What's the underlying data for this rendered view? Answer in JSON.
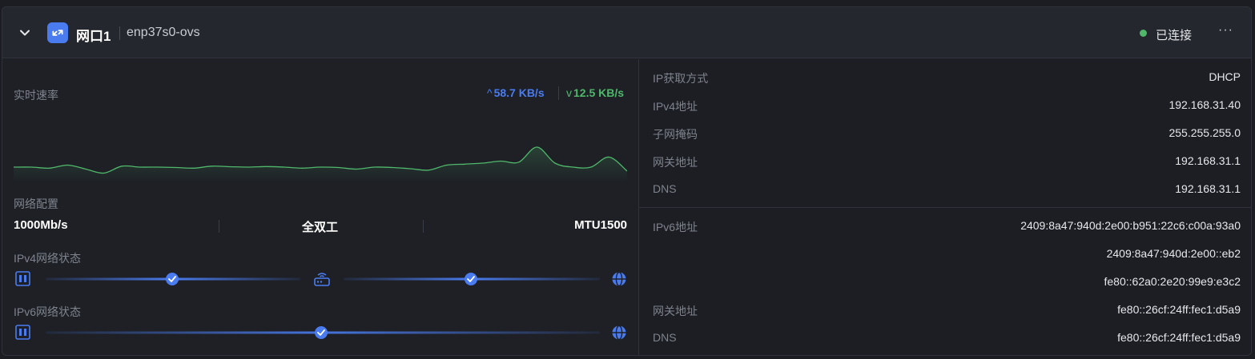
{
  "header": {
    "port_name": "网口1",
    "iface_name": "enp37s0-ovs",
    "status_text": "已连接",
    "status_color": "#4fb86b",
    "accent_color": "#4a7cf0",
    "more_label": "···"
  },
  "speed": {
    "label": "实时速率",
    "upload": "58.7 KB/s",
    "download": "12.5 KB/s",
    "upload_color": "#4a7cf0",
    "download_color": "#4fb86b"
  },
  "chart_data": {
    "type": "area",
    "series": [
      {
        "values": [
          8,
          8,
          7.5,
          9,
          7,
          5,
          8.5,
          8,
          8,
          7.8,
          7.5,
          8.5,
          8.2,
          8,
          8.3,
          8,
          7.5,
          8,
          7.8,
          7,
          8,
          7.8,
          7.2,
          6.5,
          9,
          9.5,
          10,
          11,
          10.5,
          18,
          10,
          8,
          8,
          13,
          6
        ]
      }
    ],
    "ylim": [
      0,
      24
    ],
    "grid": false
  },
  "config": {
    "label": "网络配置",
    "speed": "1000Mb/s",
    "duplex": "全双工",
    "mtu": "MTU1500"
  },
  "ipv4_status": {
    "label": "IPv4网络状态"
  },
  "ipv6_status": {
    "label": "IPv6网络状态"
  },
  "icons": {
    "chevron": "chevron-down-icon",
    "port": "swap-arrows-icon",
    "nic": "network-card-icon",
    "router": "router-icon",
    "globe": "globe-icon",
    "check": "check-circle-icon"
  },
  "ipv4": [
    {
      "key": "IP获取方式",
      "value": "DHCP"
    },
    {
      "key": "IPv4地址",
      "value": "192.168.31.40"
    },
    {
      "key": "子网掩码",
      "value": "255.255.255.0"
    },
    {
      "key": "网关地址",
      "value": "192.168.31.1"
    },
    {
      "key": "DNS",
      "value": "192.168.31.1"
    }
  ],
  "ipv6": [
    {
      "key": "IPv6地址",
      "value": "2409:8a47:940d:2e00:b951:22c6:c00a:93a0"
    },
    {
      "key": "",
      "value": "2409:8a47:940d:2e00::eb2"
    },
    {
      "key": "",
      "value": "fe80::62a0:2e20:99e9:e3c2"
    },
    {
      "key": "网关地址",
      "value": "fe80::26cf:24ff:fec1:d5a9"
    },
    {
      "key": "DNS",
      "value": "fe80::26cf:24ff:fec1:d5a9"
    }
  ]
}
